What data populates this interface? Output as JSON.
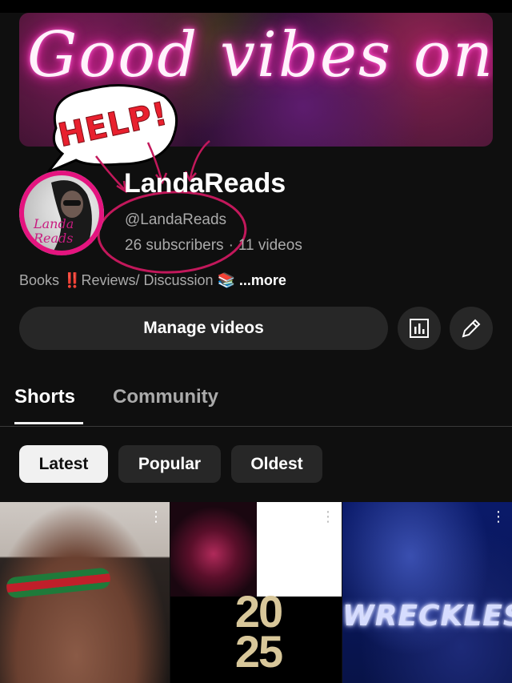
{
  "banner": {
    "text": "Good vibes only"
  },
  "annotation": {
    "help_text": "HELP!"
  },
  "avatar": {
    "script_text": "Landa Reads"
  },
  "channel": {
    "name": "LandaReads",
    "handle": "@LandaReads",
    "subscribers": "26 subscribers",
    "separator": "·",
    "videos": "11 videos",
    "description": "Books ‼️Reviews/ Discussion 📚",
    "more_label": "...more"
  },
  "actions": {
    "manage_label": "Manage videos",
    "analytics_icon": "analytics-icon",
    "edit_icon": "pencil-icon"
  },
  "tabs": [
    {
      "label": "Shorts",
      "active": true
    },
    {
      "label": "Community",
      "active": false
    }
  ],
  "chips": [
    {
      "label": "Latest",
      "selected": true
    },
    {
      "label": "Popular",
      "selected": false
    },
    {
      "label": "Oldest",
      "selected": false
    }
  ],
  "shorts": {
    "thumb2_year_top": "20",
    "thumb2_year_bottom": "25",
    "thumb3_title": "WRECKLESS"
  },
  "colors": {
    "background": "#0f0f0f",
    "button": "#272727",
    "accent_pink": "#e4147f",
    "annotation_red": "#e8202e"
  }
}
